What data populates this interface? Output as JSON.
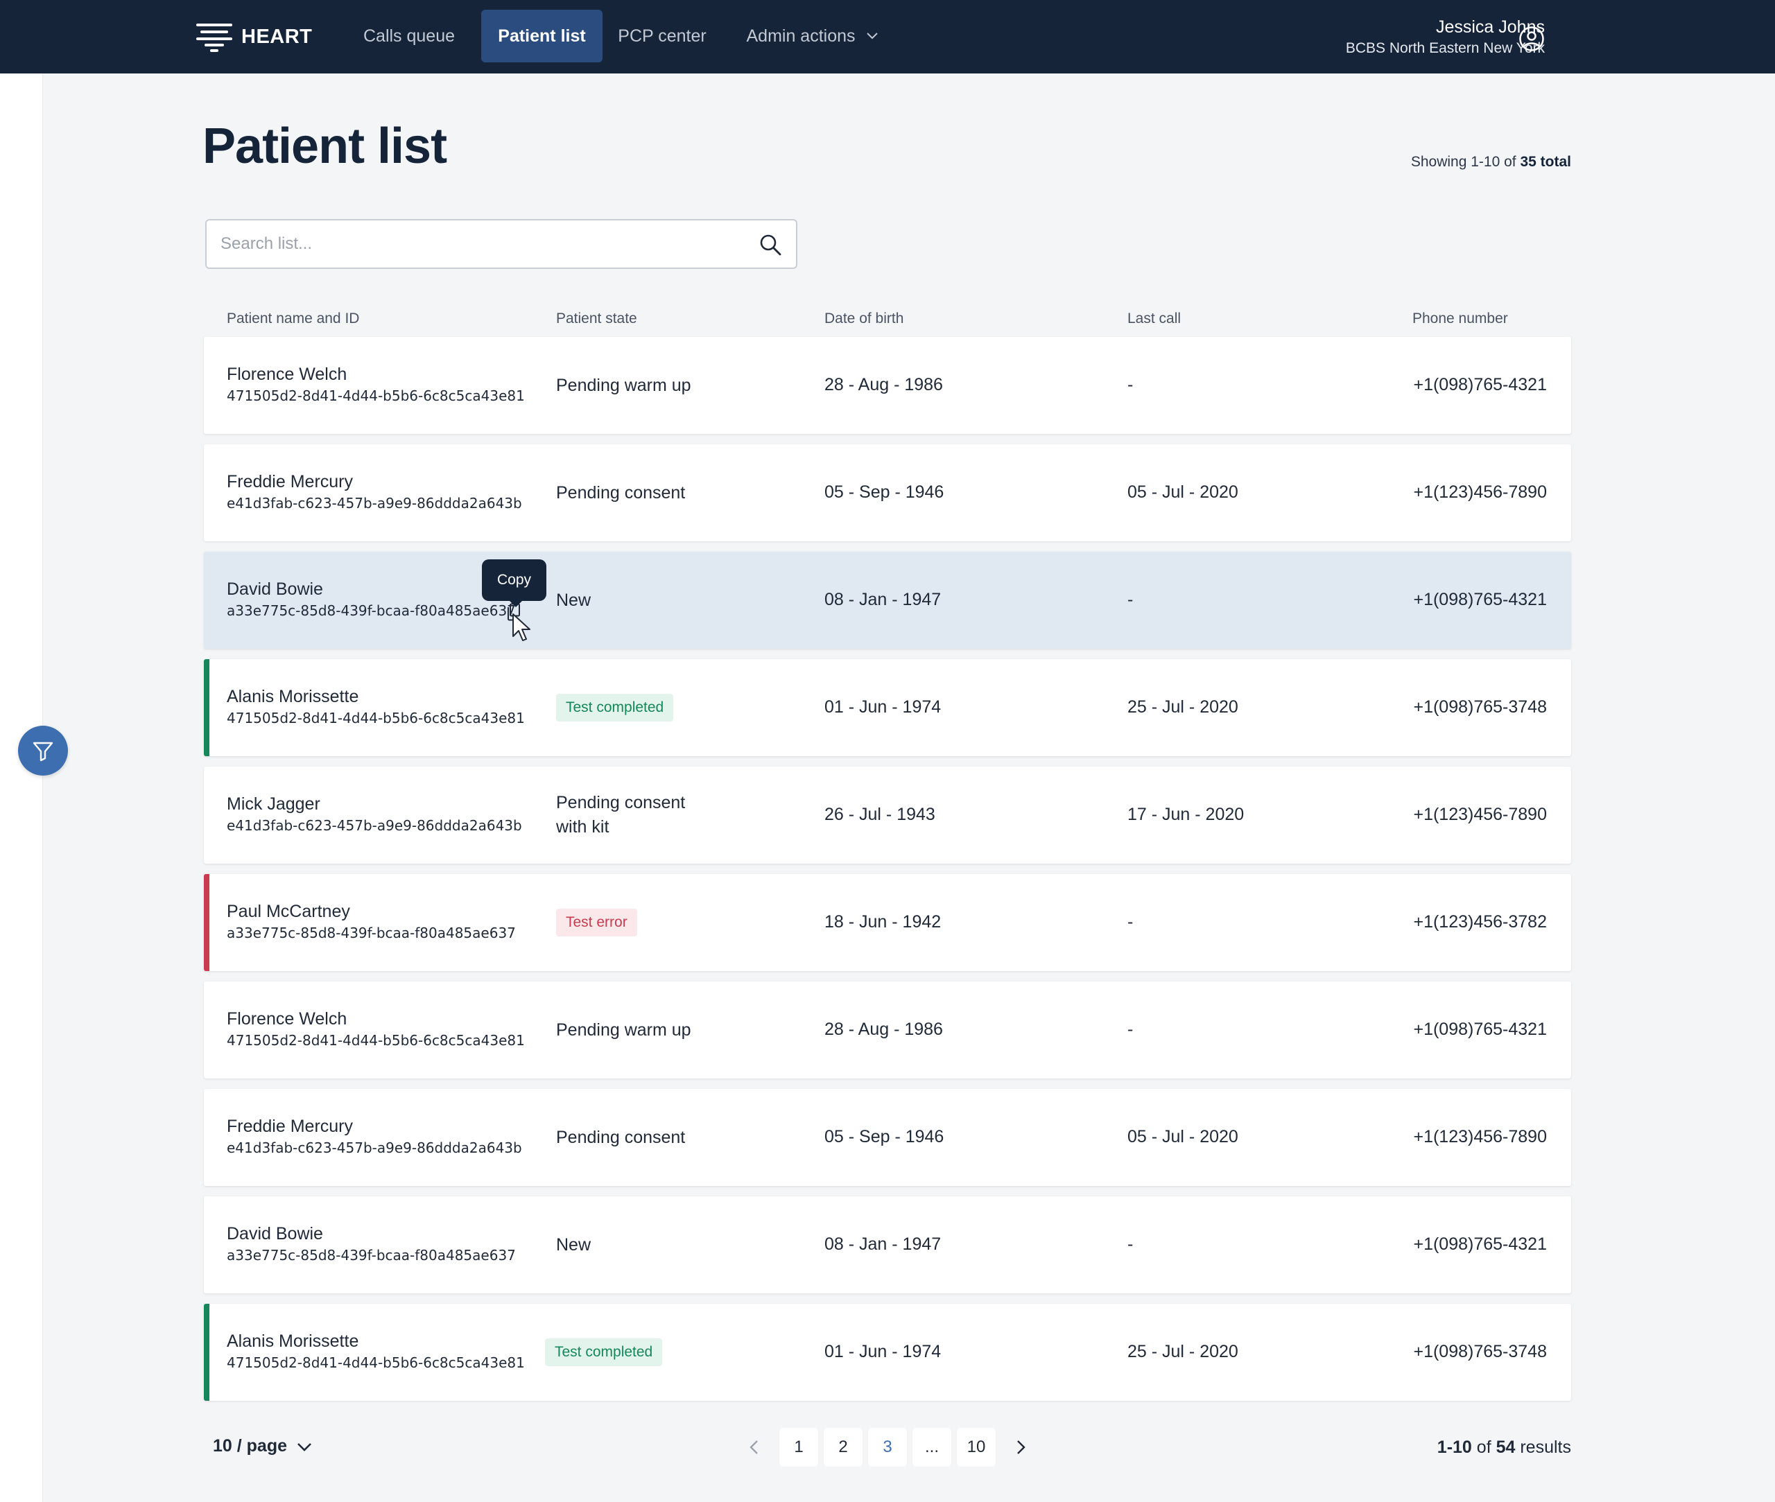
{
  "app": {
    "brand": "HEART"
  },
  "nav": {
    "items": [
      {
        "label": "Calls queue"
      },
      {
        "label": "Patient list",
        "active": true
      },
      {
        "label": "PCP center"
      },
      {
        "label": "Admin actions"
      }
    ]
  },
  "user": {
    "name": "Jessica Johns",
    "org": "BCBS North Eastern New York"
  },
  "page": {
    "title": "Patient list"
  },
  "summary": {
    "prefix": "Showing 1-10 of ",
    "total": "35 total"
  },
  "search": {
    "placeholder": "Search list...",
    "value": ""
  },
  "table": {
    "headers": [
      "Patient name and ID",
      "Patient state",
      "Date of birth",
      "Last call",
      "Phone number"
    ],
    "rows": [
      {
        "name": "Florence Welch",
        "id": "471505d2-8d41-4d44-b5b6-6c8c5ca43e81",
        "state": "Pending warm up",
        "dob": "28 - Aug - 1986",
        "last_call": "-",
        "phone": "+1(098)765-4321"
      },
      {
        "name": "Freddie Mercury",
        "id": "e41d3fab-c623-457b-a9e9-86ddda2a643b",
        "state": "Pending consent",
        "dob": "05 - Sep - 1946",
        "last_call": "05 - Jul - 2020",
        "phone": "+1(123)456-7890"
      },
      {
        "name": "David Bowie",
        "id": "a33e775c-85d8-439f-bcaa-f80a485ae637",
        "state": "New",
        "dob": "08 - Jan - 1947",
        "last_call": "-",
        "phone": "+1(098)765-4321"
      },
      {
        "name": "Alanis Morissette",
        "id": "471505d2-8d41-4d44-b5b6-6c8c5ca43e81",
        "state": "Test completed",
        "dob": "01 - Jun - 1974",
        "last_call": "25 - Jul - 2020",
        "phone": "+1(098)765-3748"
      },
      {
        "name": "Mick Jagger",
        "id": "e41d3fab-c623-457b-a9e9-86ddda2a643b",
        "state": "Pending consent with kit",
        "dob": "26 - Jul - 1943",
        "last_call": "17 - Jun - 2020",
        "phone": "+1(123)456-7890"
      },
      {
        "name": "Paul McCartney",
        "id": "a33e775c-85d8-439f-bcaa-f80a485ae637",
        "state": "Test error",
        "dob": "18 - Jun - 1942",
        "last_call": "-",
        "phone": "+1(123)456-3782"
      },
      {
        "name": "Florence Welch",
        "id": "471505d2-8d41-4d44-b5b6-6c8c5ca43e81",
        "state": "Pending warm up",
        "dob": "28 - Aug - 1986",
        "last_call": "-",
        "phone": "+1(098)765-4321"
      },
      {
        "name": "Freddie Mercury",
        "id": "e41d3fab-c623-457b-a9e9-86ddda2a643b",
        "state": "Pending consent",
        "dob": "05 - Sep - 1946",
        "last_call": "05 - Jul - 2020",
        "phone": "+1(123)456-7890"
      },
      {
        "name": "David Bowie",
        "id": "a33e775c-85d8-439f-bcaa-f80a485ae637",
        "state": "New",
        "dob": "08 - Jan - 1947",
        "last_call": "-",
        "phone": "+1(098)765-4321"
      },
      {
        "name": "Alanis Morissette",
        "id": "471505d2-8d41-4d44-b5b6-6c8c5ca43e81",
        "state": "Test completed",
        "dob": "01 - Jun - 1974",
        "last_call": "25 - Jul - 2020",
        "phone": "+1(098)765-3748"
      }
    ]
  },
  "tooltip": {
    "label": "Copy"
  },
  "pagination": {
    "page_size": "10 / page",
    "pages": [
      "1",
      "2",
      "3",
      "...",
      "10"
    ],
    "current": "3",
    "results_range": "1-10",
    "results_of": " of ",
    "results_total": "54",
    "results_suffix": " results"
  },
  "colors": {
    "nav_bg": "#16243a",
    "nav_active": "#2b4c7e",
    "accent": "#3d6fb0",
    "success": "#15875b",
    "error": "#c73c4f",
    "row_hover": "#e0e8f2"
  },
  "icons": [
    "heart-logo-icon",
    "chevron-down-icon",
    "user-circle-icon",
    "search-icon",
    "filter-icon",
    "copy-icon",
    "cursor-pointer-icon",
    "chevron-left-icon",
    "chevron-right-icon"
  ]
}
